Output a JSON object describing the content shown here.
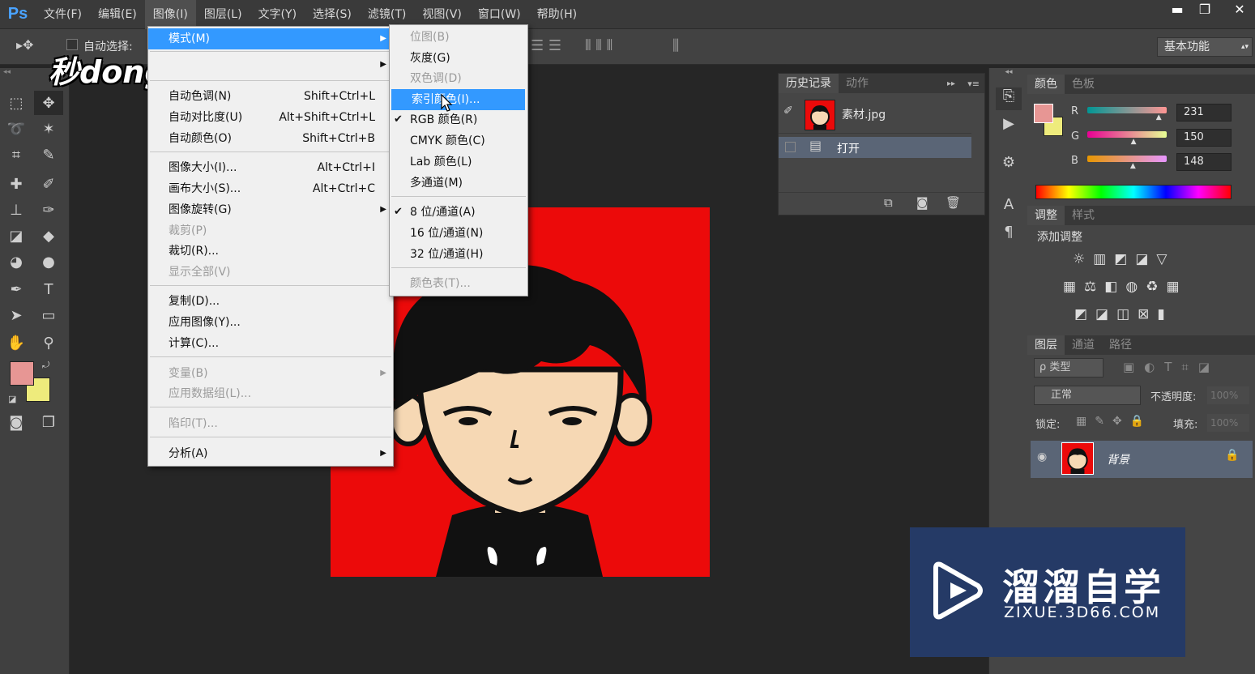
{
  "app": {
    "logo": "Ps"
  },
  "menubar": {
    "items": [
      "文件(F)",
      "编辑(E)",
      "图像(I)",
      "图层(L)",
      "文字(Y)",
      "选择(S)",
      "滤镜(T)",
      "视图(V)",
      "窗口(W)",
      "帮助(H)"
    ]
  },
  "window_controls": {
    "minimize": "▬",
    "restore": "❐",
    "close": "✕"
  },
  "options": {
    "auto_select": "自动选择:"
  },
  "workspace": {
    "label": "基本功能"
  },
  "watermark_top": "秒dong视频",
  "image_menu": {
    "mode": "模式(M)",
    "auto_tone": {
      "label": "自动色调(N)",
      "shortcut": "Shift+Ctrl+L"
    },
    "auto_contrast": {
      "label": "自动对比度(U)",
      "shortcut": "Alt+Shift+Ctrl+L"
    },
    "auto_color": {
      "label": "自动颜色(O)",
      "shortcut": "Shift+Ctrl+B"
    },
    "image_size": {
      "label": "图像大小(I)...",
      "shortcut": "Alt+Ctrl+I"
    },
    "canvas_size": {
      "label": "画布大小(S)...",
      "shortcut": "Alt+Ctrl+C"
    },
    "rotation": "图像旋转(G)",
    "crop": "裁剪(P)",
    "trim": "裁切(R)...",
    "reveal_all": "显示全部(V)",
    "duplicate": "复制(D)...",
    "apply_image": "应用图像(Y)...",
    "calculations": "计算(C)...",
    "variables": "变量(B)",
    "apply_data_set": "应用数据组(L)...",
    "trap": "陷印(T)...",
    "analysis": "分析(A)"
  },
  "mode_menu": {
    "bitmap": "位图(B)",
    "grayscale": "灰度(G)",
    "duotone": "双色调(D)",
    "indexed": "索引颜色(I)...",
    "rgb": "RGB 颜色(R)",
    "cmyk": "CMYK 颜色(C)",
    "lab": "Lab 颜色(L)",
    "multichannel": "多通道(M)",
    "bits8": "8 位/通道(A)",
    "bits16": "16 位/通道(N)",
    "bits32": "32 位/通道(H)",
    "color_table": "颜色表(T)...",
    "check": "✔"
  },
  "history": {
    "tabs": [
      "历史记录",
      "动作"
    ],
    "snapshot": "素材.jpg",
    "step": "打开"
  },
  "color_panel": {
    "tabs": [
      "颜色",
      "色板"
    ],
    "r_label": "R",
    "g_label": "G",
    "b_label": "B",
    "r": "231",
    "g": "150",
    "b": "148",
    "r_frac": 0.906,
    "g_frac": 0.588,
    "b_frac": 0.58,
    "foreground": "#e79694",
    "background": "#eeeb7c"
  },
  "adjust_panel": {
    "tabs": [
      "调整",
      "样式"
    ],
    "title": "添加调整"
  },
  "layers_panel": {
    "tabs": [
      "图层",
      "通道",
      "路径"
    ],
    "filter": "ρ 类型",
    "blend": "正常",
    "opacity_label": "不透明度:",
    "opacity": "100%",
    "lock_label": "锁定:",
    "fill_label": "填充:",
    "fill": "100%",
    "layer_name": "背景"
  },
  "watermark_corner": {
    "title": "溜溜自学",
    "url": "ZIXUE.3D66.COM"
  }
}
